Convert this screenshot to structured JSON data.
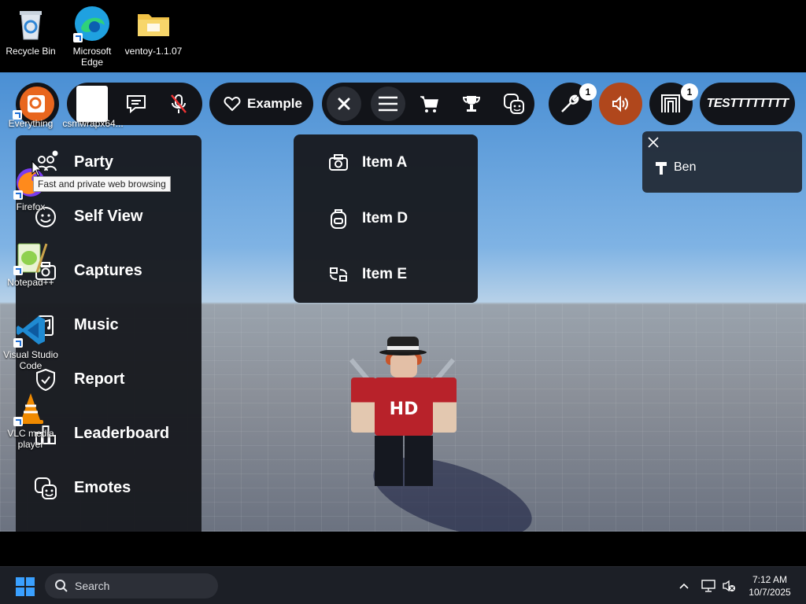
{
  "desktop": {
    "top_icons": [
      {
        "label": "Recycle Bin",
        "icon": "recycle-bin-icon"
      },
      {
        "label": "Microsoft Edge",
        "icon": "edge-icon"
      },
      {
        "label": "ventoy-1.1.07",
        "icon": "folder-icon"
      }
    ],
    "side_icons": [
      {
        "label": "Everything",
        "icon": "everything-icon"
      },
      {
        "label": "csmwrapx64...",
        "icon": "file-icon"
      },
      {
        "label": "Firefox",
        "icon": "firefox-icon"
      },
      {
        "label": "Notepad++",
        "icon": "notepadpp-icon"
      },
      {
        "label": "Visual Studio Code",
        "icon": "vscode-icon"
      },
      {
        "label": "VLC media player",
        "icon": "vlc-icon"
      }
    ],
    "tooltip": "Fast and private web browsing"
  },
  "topbar": {
    "example_label": "Example",
    "wrench_badge": "1",
    "capes_badge": "1",
    "username": "TESTTTTTTTT"
  },
  "left_menu": {
    "items": [
      {
        "label": "Party",
        "icon": "party-icon"
      },
      {
        "label": "Self View",
        "icon": "self-view-icon"
      },
      {
        "label": "Captures",
        "icon": "camera-icon"
      },
      {
        "label": "Music",
        "icon": "music-icon"
      },
      {
        "label": "Report",
        "icon": "shield-icon"
      },
      {
        "label": "Leaderboard",
        "icon": "leaderboard-icon"
      },
      {
        "label": "Emotes",
        "icon": "emotes-icon"
      }
    ]
  },
  "dropdown": {
    "items": [
      {
        "label": "Item A",
        "icon": "camera-icon"
      },
      {
        "label": "Item D",
        "icon": "backpack-icon"
      },
      {
        "label": "Item E",
        "icon": "swap-icon"
      }
    ]
  },
  "players": {
    "name": "Ben"
  },
  "taskbar": {
    "search_label": "Search",
    "time": "7:12 AM",
    "date": "10/7/2025"
  },
  "colors": {
    "sky": "#4a8fd4",
    "panel": "#181a1f",
    "audio_button": "#b0471c",
    "accent": "#3aa0ff"
  }
}
